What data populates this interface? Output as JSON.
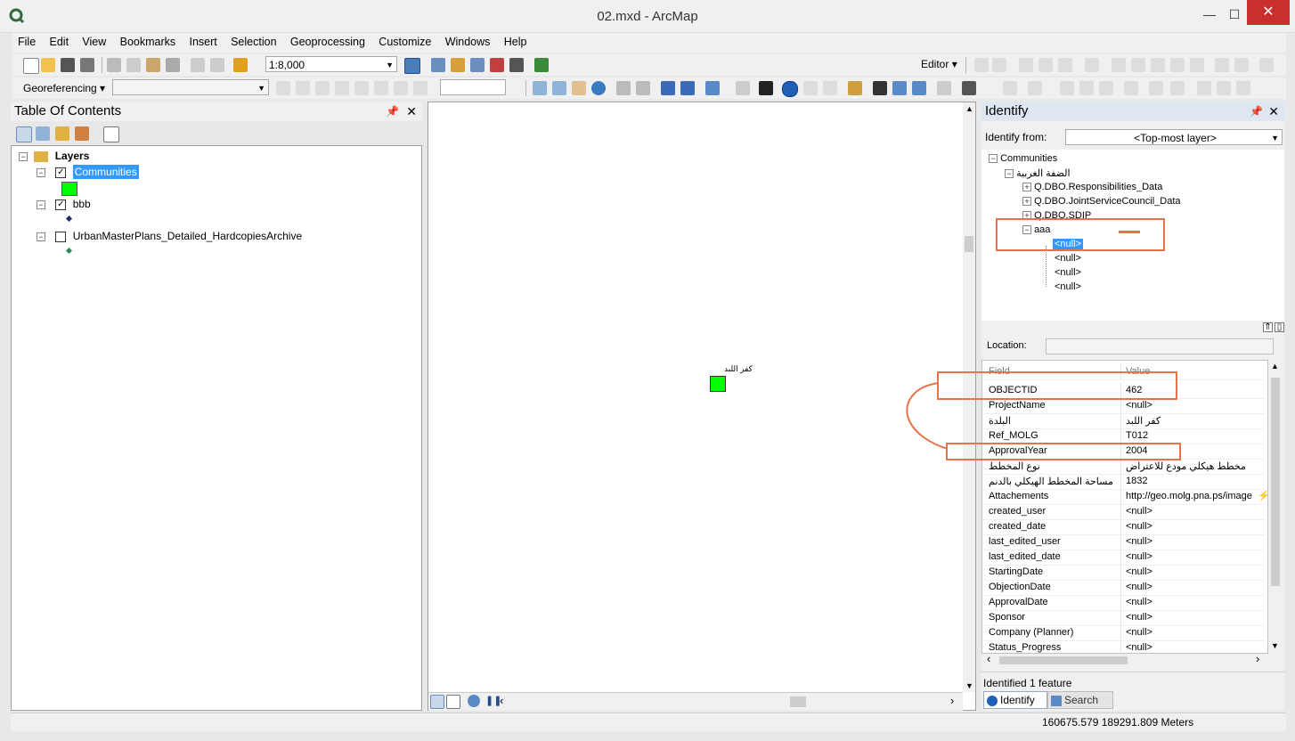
{
  "window": {
    "title": "02.mxd - ArcMap",
    "minimize": "—",
    "maximize": "☐",
    "close": "✕"
  },
  "menu": [
    "File",
    "Edit",
    "View",
    "Bookmarks",
    "Insert",
    "Selection",
    "Geoprocessing",
    "Customize",
    "Windows",
    "Help"
  ],
  "toolbar": {
    "scale_value": "1:8,000",
    "editor_label": "Editor",
    "georef_label": "Georeferencing"
  },
  "toc": {
    "title": "Table Of Contents",
    "root": "Layers",
    "layers": [
      {
        "name": "Communities",
        "checked": true,
        "selected": true,
        "symbol_color": "#00ff00"
      },
      {
        "name": "bbb",
        "checked": true,
        "selected": false,
        "symbol_color": "#1f2d6b"
      },
      {
        "name": "UrbanMasterPlans_Detailed_HardcopiesArchive",
        "checked": false,
        "selected": false,
        "symbol_color": "#2e8b57"
      }
    ]
  },
  "map": {
    "feature_label": "كفر اللبد",
    "feature_color": "#00ff00"
  },
  "identify": {
    "title": "Identify",
    "from_label": "Identify from:",
    "from_value": "<Top-most layer>",
    "tree": {
      "root": "Communities",
      "feature": "الضفة الغربية",
      "children": [
        "Q.DBO.Responsibilities_Data",
        "Q.DBO.JointServiceCouncil_Data",
        "Q.DBO.SDIP",
        "aaa"
      ],
      "nulls": [
        "<null>",
        "<null>",
        "<null>",
        "<null>"
      ]
    },
    "location_label": "Location:",
    "columns": {
      "field": "Field",
      "value": "Value"
    },
    "rows": [
      {
        "field": "OBJECTID",
        "value": "462"
      },
      {
        "field": "ProjectName",
        "value": "<null>"
      },
      {
        "field": "البلدة",
        "value": "كفر اللبد"
      },
      {
        "field": "Ref_MOLG",
        "value": "T012"
      },
      {
        "field": "ApprovalYear",
        "value": "2004"
      },
      {
        "field": "نوع المخطط",
        "value": "مخطط هيكلي مودع للاعتراض"
      },
      {
        "field": "مساحة المخطط الهيكلي بالدنم",
        "value": "1832"
      },
      {
        "field": "Attachements",
        "value": "http://geo.molg.pna.ps/image"
      },
      {
        "field": "created_user",
        "value": "<null>"
      },
      {
        "field": "created_date",
        "value": "<null>"
      },
      {
        "field": "last_edited_user",
        "value": "<null>"
      },
      {
        "field": "last_edited_date",
        "value": "<null>"
      },
      {
        "field": "StartingDate",
        "value": "<null>"
      },
      {
        "field": "ObjectionDate",
        "value": "<null>"
      },
      {
        "field": "ApprovalDate",
        "value": "<null>"
      },
      {
        "field": "Sponsor",
        "value": "<null>"
      },
      {
        "field": "Company (Planner)",
        "value": "<null>"
      },
      {
        "field": "Status_Progress",
        "value": "<null>"
      }
    ],
    "status": "Identified 1 feature",
    "tabs": [
      "Identify",
      "Search"
    ]
  },
  "statusbar": {
    "coords": "160675.579  189291.809 Meters"
  },
  "colors": {
    "accent": "#3399ff",
    "highlight_box": "#e8734a",
    "panel_header": "#dde6f1"
  }
}
